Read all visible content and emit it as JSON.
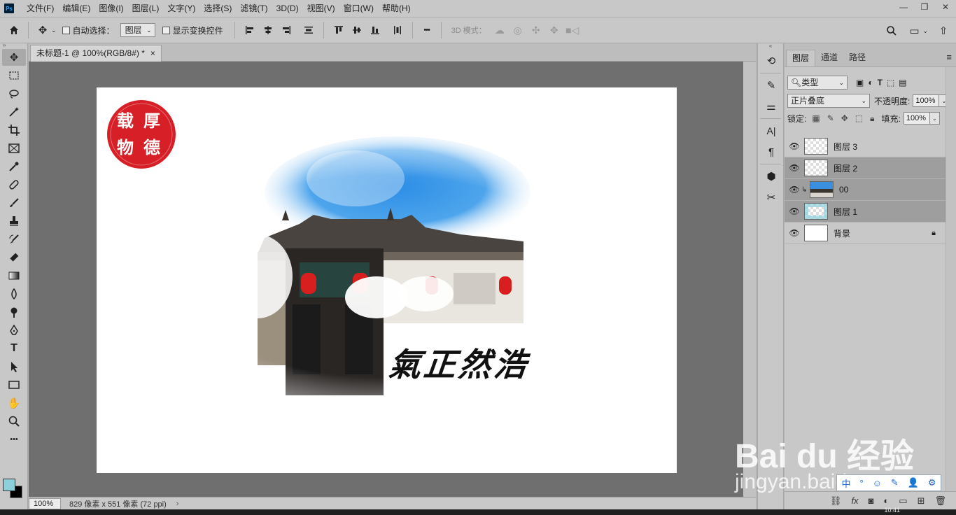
{
  "app": {
    "logo": "Ps"
  },
  "menu": [
    "文件(F)",
    "编辑(E)",
    "图像(I)",
    "图层(L)",
    "文字(Y)",
    "选择(S)",
    "滤镜(T)",
    "3D(D)",
    "视图(V)",
    "窗口(W)",
    "帮助(H)"
  ],
  "window_controls": {
    "minimize": "—",
    "restore": "❐",
    "close": "✕"
  },
  "options": {
    "auto_select_label": "自动选择：",
    "auto_select_target": "图层",
    "show_transform_label": "显示变换控件",
    "more": "•••",
    "mode_3d_label": "3D 模式："
  },
  "document": {
    "tab_title": "未标题-1 @ 100%(RGB/8#) *",
    "tab_close": "×",
    "seal_chars": [
      "载",
      "厚",
      "物",
      "德"
    ],
    "calligraphy": "氣正然浩"
  },
  "status": {
    "zoom": "100%",
    "doc_info": "829 像素 x 551 像素 (72 ppi)",
    "arrow": "›"
  },
  "taskbar": {
    "time": "10:41"
  },
  "colors": {
    "foreground": "#8dd0dc",
    "background": "#000000",
    "seal_red": "#d61f26"
  },
  "panel": {
    "tabs": [
      "图层",
      "通道",
      "路径"
    ],
    "filter_kind": "类型",
    "blend_mode": "正片叠底",
    "opacity_label": "不透明度:",
    "opacity_value": "100%",
    "lock_label": "锁定:",
    "fill_label": "填充:",
    "fill_value": "100%",
    "layers": [
      {
        "name": "图层 3",
        "selected": false,
        "thumb": "checker"
      },
      {
        "name": "图层 2",
        "selected": true,
        "thumb": "checker"
      },
      {
        "name": "00",
        "selected": true,
        "thumb": "photo",
        "clipped": true
      },
      {
        "name": "图层 1",
        "selected": true,
        "thumb": "cyan"
      },
      {
        "name": "背景",
        "selected": false,
        "thumb": "white",
        "locked": true
      }
    ]
  },
  "watermark": {
    "brand": "Bai du 经验",
    "url": "jingyan.baidu.com"
  },
  "ime": [
    "中",
    "°",
    "☺",
    "✎",
    "👤",
    "⚙"
  ],
  "icons": {
    "tools": [
      "move-icon",
      "marquee-icon",
      "lasso-icon",
      "magic-wand-icon",
      "crop-icon",
      "frame-icon",
      "eyedropper-icon",
      "healing-icon",
      "brush-icon",
      "stamp-icon",
      "history-brush-icon",
      "eraser-icon",
      "gradient-icon",
      "blur-icon",
      "dodge-icon",
      "pen-icon",
      "type-icon",
      "path-select-icon",
      "rectangle-icon",
      "hand-icon",
      "zoom-icon",
      "more-tools-icon"
    ]
  }
}
